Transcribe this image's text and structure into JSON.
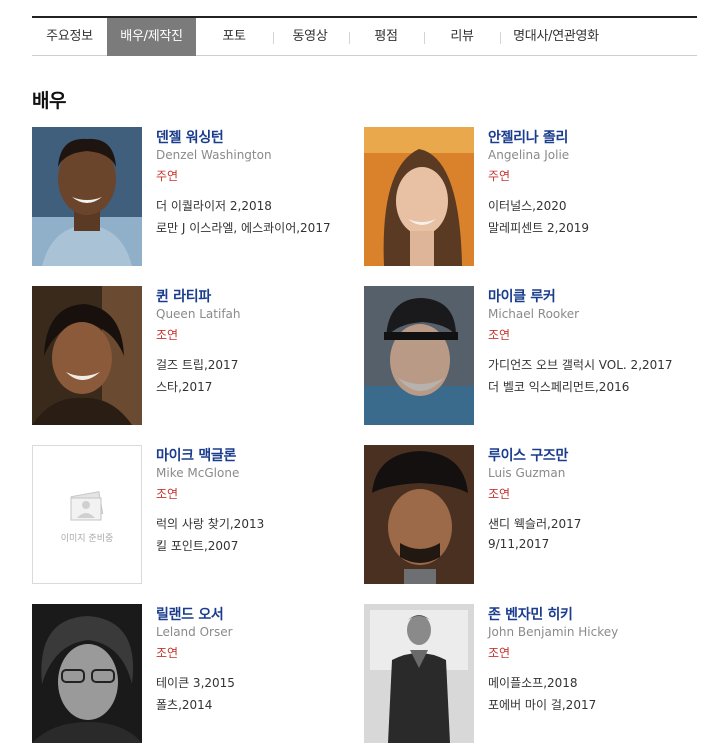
{
  "tabs": [
    {
      "label": "주요정보",
      "active": false
    },
    {
      "label": "배우/제작진",
      "active": true
    },
    {
      "label": "포토",
      "active": false
    },
    {
      "label": "동영상",
      "active": false
    },
    {
      "label": "평점",
      "active": false
    },
    {
      "label": "리뷰",
      "active": false
    },
    {
      "label": "명대사/연관영화",
      "active": false
    }
  ],
  "section_title": "배우",
  "placeholder_text": "이미지 준비중",
  "actors": [
    {
      "name": "덴젤 워싱턴",
      "english": "Denzel Washington",
      "role": "주연",
      "films": [
        "더 이퀄라이저 2,2018",
        "로만 J 이스라엘, 에스콰이어,2017"
      ]
    },
    {
      "name": "안젤리나 졸리",
      "english": "Angelina Jolie",
      "role": "주연",
      "films": [
        "이터널스,2020",
        "말레피센트 2,2019"
      ]
    },
    {
      "name": "퀸 라티파",
      "english": "Queen Latifah",
      "role": "조연",
      "films": [
        "걸즈 트립,2017",
        "스타,2017"
      ]
    },
    {
      "name": "마이클 루커",
      "english": "Michael Rooker",
      "role": "조연",
      "films": [
        "가디언즈 오브 갤럭시 VOL. 2,2017",
        "더 벨코 익스페리먼트,2016"
      ]
    },
    {
      "name": "마이크 맥글론",
      "english": "Mike McGlone",
      "role": "조연",
      "films": [
        "럭의 사랑 찾기,2013",
        "킬 포인트,2007"
      ]
    },
    {
      "name": "루이스 구즈만",
      "english": "Luis Guzman",
      "role": "조연",
      "films": [
        "샌디 웩슬러,2017",
        "9/11,2017"
      ]
    },
    {
      "name": "릴랜드 오서",
      "english": "Leland Orser",
      "role": "조연",
      "films": [
        "테이큰 3,2015",
        "폴츠,2014"
      ]
    },
    {
      "name": "존 벤자민 히키",
      "english": "John Benjamin Hickey",
      "role": "조연",
      "films": [
        "메이플소프,2018",
        "포에버 마이 걸,2017"
      ]
    }
  ]
}
